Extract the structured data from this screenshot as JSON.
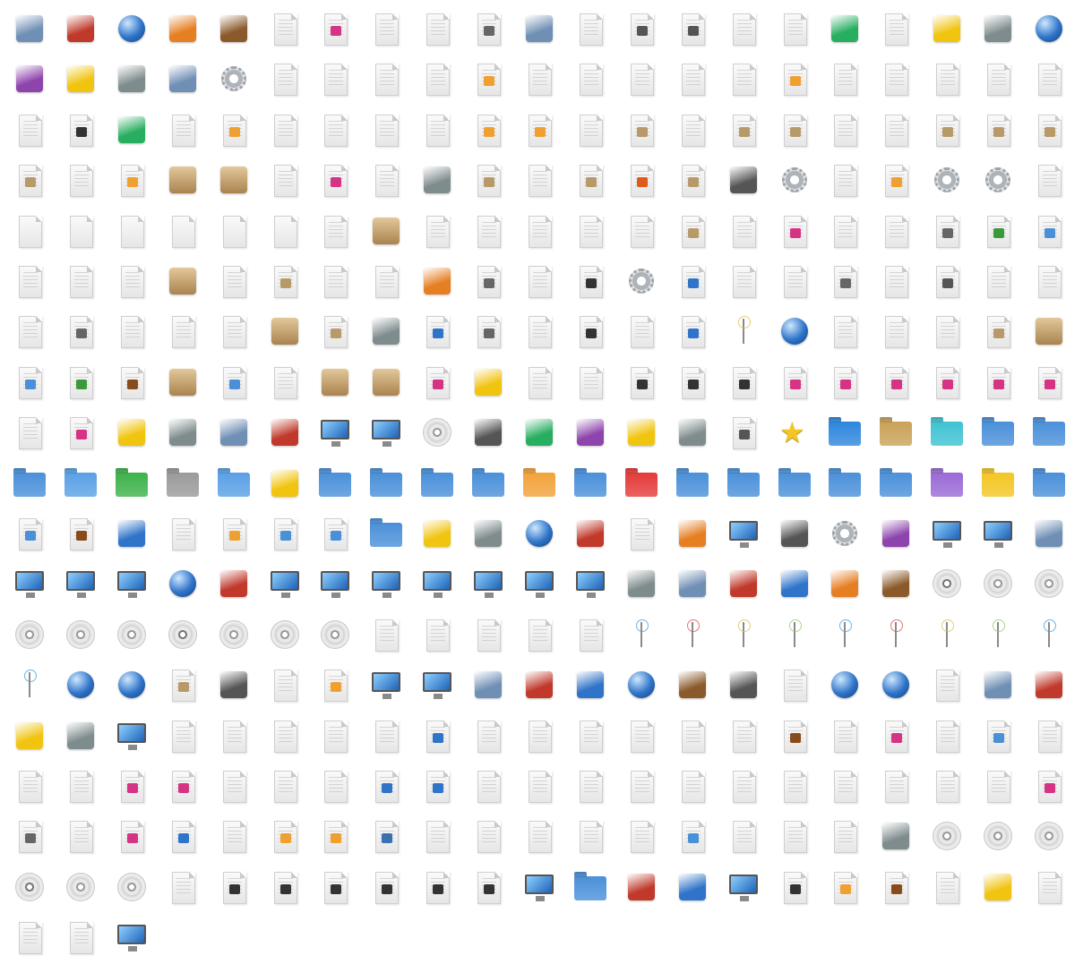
{
  "title": "",
  "colors": {
    "background": "#ffffff"
  },
  "icon_grid": {
    "columns": 21,
    "rows": [
      [
        "calculator",
        "dictionary-book",
        "globe",
        "rss-reader",
        "address-book",
        "pdf-document",
        "audio-document",
        "spreadsheet-document",
        "spreadsheet-document",
        "script-document",
        "pdf-logo",
        "text-document",
        "disc-document",
        "disc-document",
        "text-document",
        "template-document",
        "rss-feed",
        "text-document",
        "hard-hat",
        "paint-palette",
        "globe"
      ],
      [
        "film-slate",
        "typewriter",
        "network-users",
        "flask",
        "gear",
        "text-document",
        "color-document",
        "presentation-document",
        "spreadsheet-document",
        "image-document",
        "color-document",
        "text-document",
        "text-document",
        "text-document",
        "drawing-document",
        "image-document",
        "presentation-document",
        "presentation-document",
        "spreadsheet-document",
        "spreadsheet-document",
        "text-document"
      ],
      [
        "text-document",
        "video-document",
        "pen-signature",
        "text-document",
        "image-document",
        "text-document",
        "text-document",
        "text-document",
        "spreadsheet-document",
        "image-document",
        "image-document",
        "text-document",
        "package-document",
        "text-document",
        "package-document",
        "package-document",
        "spreadsheet-document",
        "text-document",
        "package-document",
        "package-document",
        "package-document"
      ],
      [
        "package-document",
        "text-document",
        "image-document",
        "package-box",
        "package-box",
        "stripes-document",
        "audio-document",
        "text-document",
        "debian-logo",
        "package-document",
        "stripes-document",
        "package-document",
        "firefox-document",
        "package-document",
        "drafting-compass",
        "gear",
        "text-document",
        "image-document",
        "gear",
        "gear",
        "font-document"
      ],
      [
        "font-a",
        "font-o",
        "font-a",
        "font-a",
        "font-t",
        "font-a",
        "text-document",
        "package-box",
        "stripes-document",
        "stripes-document",
        "text-document",
        "color-document",
        "text-document",
        "package-document",
        "text-document",
        "audio-document",
        "text-document",
        "color-wheel-document",
        "script-document",
        "download-document",
        "link-document"
      ],
      [
        "chart-document",
        "drawing-document",
        "text-document",
        "package-box",
        "text-document",
        "package-document",
        "stripes-document",
        "text-document",
        "blue-shell",
        "script-document",
        "code-document",
        "video-document",
        "gear",
        "globe-document",
        "text-document",
        "text-document",
        "script-document",
        "stripes-document",
        "disc-document",
        "text-document",
        "text-document"
      ],
      [
        "orange-document",
        "script-document",
        "text-document",
        "text-document",
        "spreadsheet-document",
        "package-box",
        "package-document",
        "ruby-gem",
        "globe-document",
        "script-document",
        "text-document",
        "video-document",
        "spreadsheet-document",
        "globe-document",
        "server-tower",
        "globe",
        "text-document",
        "text-document",
        "text-document",
        "package-document",
        "package-box"
      ],
      [
        "link-document",
        "recycle-document",
        "bookmark-document",
        "package-box",
        "link-document",
        "text-document",
        "package-box",
        "package-box",
        "audio-document",
        "circuit-board",
        "piano-document",
        "piano-document",
        "video-document",
        "video-document",
        "video-document",
        "audio-document",
        "audio-document",
        "audio-document",
        "audio-document",
        "audio-document",
        "audio-document"
      ],
      [
        "headset-document",
        "audio-document",
        "camera",
        "certificate",
        "printer",
        "clock",
        "laptop",
        "desktop-computer",
        "disc",
        "hard-drive",
        "scanner",
        "drive",
        "usb-stick",
        "usb-drive",
        "disc-document",
        "star",
        "folder",
        "folder",
        "folder",
        "folder",
        "folder"
      ],
      [
        "folder",
        "folder",
        "folder",
        "folder",
        "folder",
        "address-book",
        "folder",
        "folder",
        "folder",
        "folder",
        "folder",
        "folder",
        "folder",
        "folder",
        "folder",
        "folder",
        "folder",
        "folder",
        "folder",
        "folder",
        "folder"
      ],
      [
        "link-document",
        "bookmark-document",
        "color-grid",
        "swoosh-document",
        "image-document",
        "link-document",
        "link-document",
        "folder",
        "keyboard",
        "mouse",
        "globe-window",
        "firewall",
        "puzzle-document",
        "chalkboard",
        "chart-window",
        "bug",
        "gear-tools",
        "network-drive",
        "database-window",
        "terminal-window",
        "padlock"
      ],
      [
        "laptop",
        "window",
        "image-window",
        "globe",
        "calendar-upload",
        "calendar-window",
        "image-window",
        "paint-window",
        "spreadsheet-window",
        "calendar-window",
        "image-window",
        "mail-window",
        "cpu-card",
        "card-reader",
        "cpu-chip",
        "sd-card",
        "memory-card",
        "floppy-disk",
        "audio-disc",
        "disc",
        "disc"
      ],
      [
        "disc",
        "disc",
        "video-disc",
        "audio-disc",
        "disc",
        "disc",
        "video-disc",
        "text-document",
        "text-document",
        "text-document",
        "text-document",
        "speaker-document",
        "server-tower",
        "pin",
        "antenna",
        "antenna",
        "antenna",
        "antenna",
        "antenna",
        "antenna",
        "antenna"
      ],
      [
        "antenna",
        "globe",
        "globe",
        "package-document",
        "refresh-drive",
        "text-document",
        "image-document",
        "tools-screen",
        "monitor",
        "wrench-tools",
        "bluetooth",
        "bluetooth",
        "globe-tools",
        "wrench-tools",
        "printer",
        "text-document",
        "globe-refresh",
        "globe-network",
        "key-document",
        "database",
        "kde-logo"
      ],
      [
        "media-player",
        "flashlight",
        "monitor",
        "text-document",
        "text-document",
        "spreadsheet-document",
        "text-document",
        "text-document",
        "globe-document",
        "text-document",
        "text-document",
        "text-document",
        "text-document",
        "text-document",
        "text-document",
        "bookmark-document",
        "text-document",
        "audio-document",
        "text-document",
        "link-document",
        "text-document"
      ],
      [
        "tex-document",
        "text-document",
        "audio-document",
        "audio-document",
        "text-document",
        "text-document",
        "text-document",
        "globe-document",
        "globe-document",
        "text-document",
        "text-document",
        "text-document",
        "text-document",
        "text-document",
        "text-document",
        "text-document",
        "text-document",
        "text-document",
        "text-document",
        "text-document",
        "audio-document"
      ],
      [
        "script-document",
        "text-document",
        "audio-document",
        "globe-document",
        "text-document",
        "image-document",
        "image-document",
        "python-document",
        "text-document",
        "text-document",
        "text-document",
        "text-document",
        "text-document",
        "link-document",
        "tex-document",
        "text-document",
        "text-document",
        "tape-device",
        "disc",
        "disc",
        "disc"
      ],
      [
        "audio-disc",
        "disc-drive",
        "disc-drive",
        "text-document",
        "video-document",
        "video-document",
        "video-document",
        "video-document",
        "video-document",
        "video-document",
        "image-window",
        "home-folder",
        "trash-full",
        "trash-empty",
        "monitor",
        "video-document",
        "image-document",
        "bookmark-document",
        "text-document",
        "address-book",
        "text-document"
      ],
      [
        "text-document",
        "spreadsheet-document",
        "window"
      ]
    ]
  }
}
